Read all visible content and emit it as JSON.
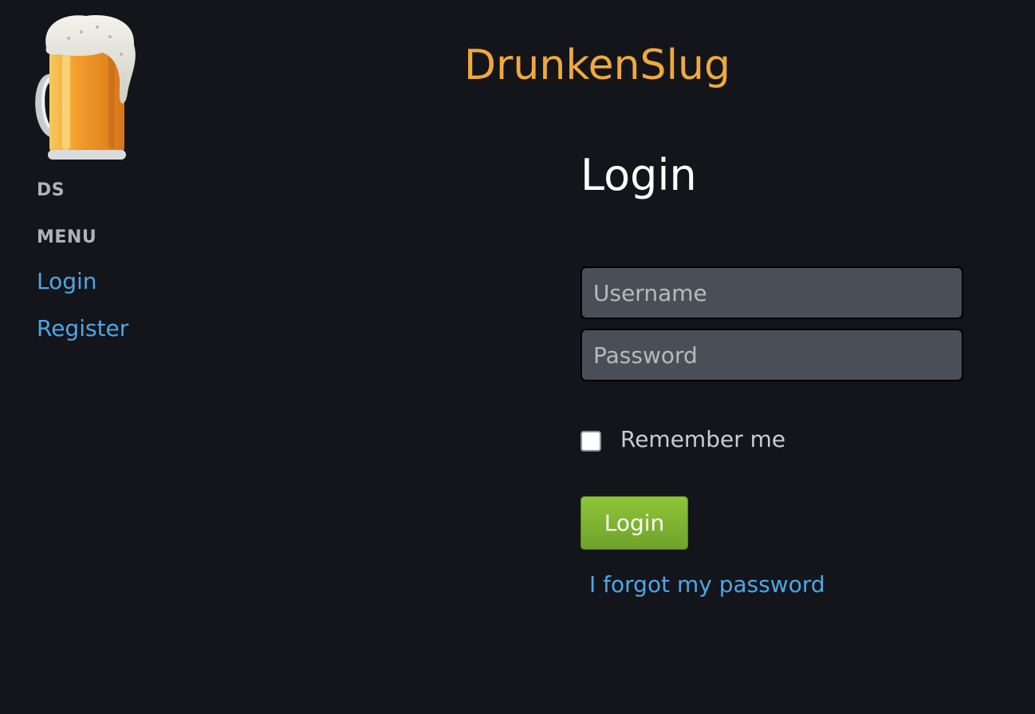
{
  "site": {
    "title": "DrunkenSlug",
    "logo_icon": "beer-mug-icon"
  },
  "sidebar": {
    "brand": "DS",
    "menu_heading": "MENU",
    "links": [
      {
        "label": "Login"
      },
      {
        "label": "Register"
      }
    ]
  },
  "login_form": {
    "title": "Login",
    "username": {
      "value": "",
      "placeholder": "Username"
    },
    "password": {
      "value": "",
      "placeholder": "Password"
    },
    "remember_label": "Remember me",
    "remember_checked": false,
    "submit_label": "Login",
    "forgot_label": "I forgot my password"
  },
  "colors": {
    "background": "#13151a",
    "title_accent": "#f0a93c",
    "link": "#4ea6e6",
    "button": "#7db432"
  }
}
